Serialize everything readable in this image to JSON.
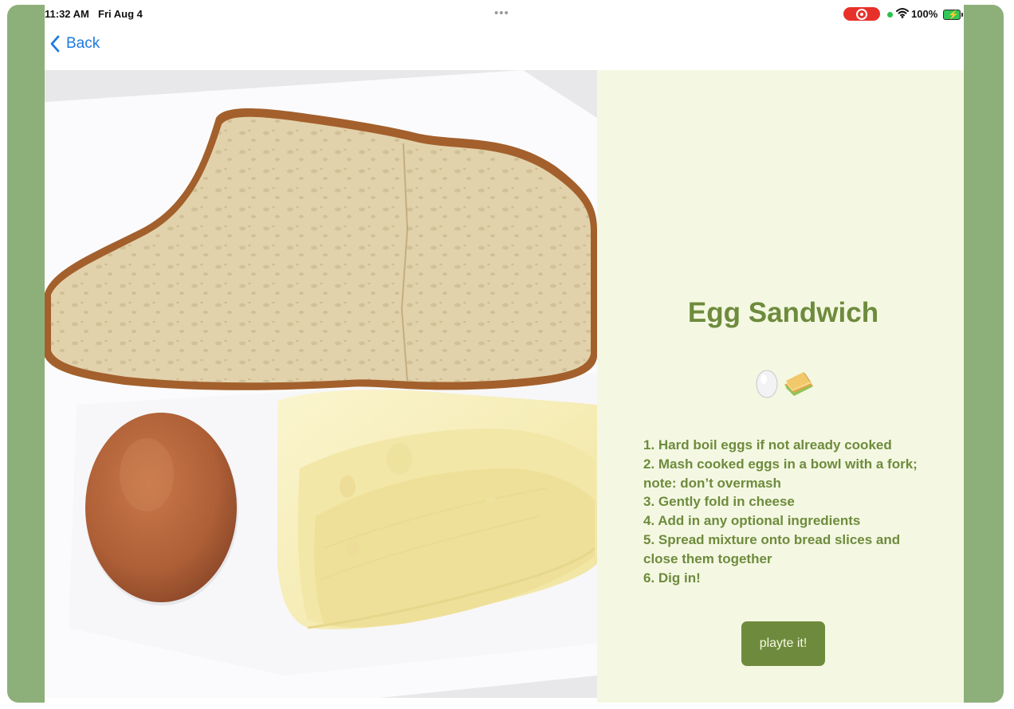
{
  "status_bar": {
    "time": "11:32 AM",
    "date": "Fri Aug 4",
    "dots": "•••",
    "battery": "100%"
  },
  "nav": {
    "back_label": "Back"
  },
  "recipe": {
    "title": "Egg Sandwich",
    "emojis": [
      "egg",
      "sandwich"
    ],
    "steps": [
      "1. Hard boil eggs if not already cooked",
      "2. Mash cooked eggs in a bowl with a fork; note: don’t overmash",
      "3. Gently fold in cheese",
      "4. Add in any optional ingredients",
      "5. Spread mixture onto bread slices and close them together",
      "6. Dig in!"
    ],
    "button_label": "playte it!"
  },
  "colors": {
    "frame": "#8db07a",
    "accent": "#6e8b3d",
    "panel_bg": "#f4f8e2",
    "link": "#1f7ae0",
    "record": "#e8302b"
  }
}
